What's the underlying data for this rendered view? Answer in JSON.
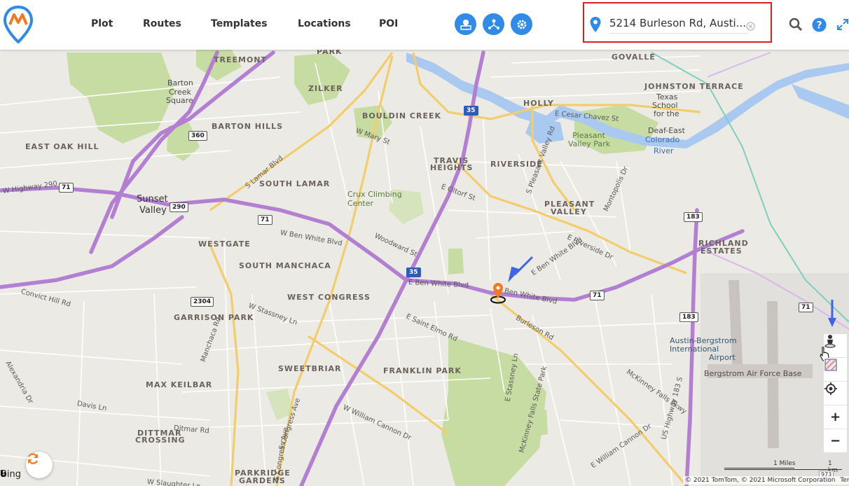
{
  "nav": {
    "items": [
      {
        "label": "Plot"
      },
      {
        "label": "Routes"
      },
      {
        "label": "Templates"
      },
      {
        "label": "Locations"
      },
      {
        "label": "POI"
      }
    ],
    "action_icons": [
      "map-pin-board-icon",
      "people-network-icon",
      "gear-icon"
    ],
    "accent": "#2f8ae8"
  },
  "search": {
    "value": "5214 Burleson Rd, Austi..."
  },
  "map": {
    "neighborhoods": [
      {
        "label": "TREEMONT"
      },
      {
        "label": "ZILKER"
      },
      {
        "label": "BOULDIN CREEK"
      },
      {
        "label": "BARTON HILLS"
      },
      {
        "label": "EAST OAK HILL"
      },
      {
        "label": "SOUTH LAMAR"
      },
      {
        "label": "TRAVIS"
      },
      {
        "label": "HEIGHTS"
      },
      {
        "label": "RIVERSIDE"
      },
      {
        "label": "WESTGATE"
      },
      {
        "label": "SOUTH MANCHACA"
      },
      {
        "label": "WEST CONGRESS"
      },
      {
        "label": "GARRISON PARK"
      },
      {
        "label": "SWEETBRIAR"
      },
      {
        "label": "FRANKLIN PARK"
      },
      {
        "label": "MAX KEILBAR"
      },
      {
        "label": "DITTMAR"
      },
      {
        "label": "CROSSING"
      },
      {
        "label": "PARKRIDGE"
      },
      {
        "label": "GARDENS"
      },
      {
        "label": "GOVALLE"
      },
      {
        "label": "JOHNSTON TERRACE"
      },
      {
        "label": "HOLLY"
      },
      {
        "label": "PLEASANT"
      },
      {
        "label": "VALLEY"
      },
      {
        "label": "RICHLAND"
      },
      {
        "label": "ESTATES"
      },
      {
        "label": "PARK"
      }
    ],
    "places": [
      {
        "label": "Barton"
      },
      {
        "label": "Creek"
      },
      {
        "label": "Square"
      },
      {
        "label": "Sunset"
      },
      {
        "label": "Valley"
      },
      {
        "label": "Crux Climbing"
      },
      {
        "label": "Center"
      },
      {
        "label": "Pleasant"
      },
      {
        "label": "Valley Park"
      },
      {
        "label": "Texas"
      },
      {
        "label": "School"
      },
      {
        "label": "for the"
      },
      {
        "label": "Deaf-East"
      },
      {
        "label": "Austin-Bergstrom"
      },
      {
        "label": "International"
      },
      {
        "label": "Airport"
      },
      {
        "label": "Bergstrom Air Force Base"
      }
    ],
    "water": [
      {
        "label": "Colorado"
      },
      {
        "label": "River"
      }
    ],
    "roads": [
      {
        "label": "W Ben White Blvd"
      },
      {
        "label": "E Ben White Blvd"
      },
      {
        "label": "Ben White Blvd"
      },
      {
        "label": "E Ben White Blvd"
      },
      {
        "label": "S Lamar Blvd"
      },
      {
        "label": "S Congress Ave"
      },
      {
        "label": "S Congress Ave"
      },
      {
        "label": "Burleson Rd"
      },
      {
        "label": "McKinney Falls State Park"
      },
      {
        "label": "W Stassney Ln"
      },
      {
        "label": "E Stassney Ln"
      },
      {
        "label": "W William Cannon Dr"
      },
      {
        "label": "E William Cannon Dr"
      },
      {
        "label": "W Slaughter Ln"
      },
      {
        "label": "E Oltorf St"
      },
      {
        "label": "E Riverside Dr"
      },
      {
        "label": "US Highway 183 S"
      },
      {
        "label": "McKinney Falls Pkwy"
      },
      {
        "label": "W Highway 290"
      },
      {
        "label": "Convict Hill Rd"
      },
      {
        "label": "E Cesar Chavez St"
      },
      {
        "label": "W Mary St"
      },
      {
        "label": "Woodward St"
      },
      {
        "label": "E Saint Elmo Rd"
      },
      {
        "label": "Montopolis Dr"
      },
      {
        "label": "Ditmar Rd"
      },
      {
        "label": "Davis Ln"
      },
      {
        "label": "Manchaca Rd"
      },
      {
        "label": "S Pleasant Valley Rd"
      },
      {
        "label": "Alexandria Dr"
      }
    ],
    "shields": [
      {
        "label": "71"
      },
      {
        "label": "71"
      },
      {
        "label": "71"
      },
      {
        "label": "290"
      },
      {
        "label": "360"
      },
      {
        "label": "35"
      },
      {
        "label": "35"
      },
      {
        "label": "183"
      },
      {
        "label": "183"
      },
      {
        "label": "2304"
      },
      {
        "label": "71"
      }
    ],
    "attribution": "© 2021 TomTom, © 2021 Microsoft Corporation",
    "terms": "Terms",
    "scale_miles": "1 Miles",
    "scale_km": "1 km",
    "scale_px": "973",
    "bing": "Bing"
  },
  "tools": [
    {
      "icon": "street-view-person-icon"
    },
    {
      "icon": "map-layers-icon"
    },
    {
      "icon": "locate-me-icon"
    },
    {
      "icon": "zoom-in-icon",
      "label": "+"
    },
    {
      "icon": "zoom-out-icon",
      "label": "−"
    }
  ],
  "colors": {
    "highway": "#b27fd2",
    "major_road": "#f3cd6b",
    "park": "#c7dca2",
    "water": "#a9c9f0",
    "pin": "#f47a22",
    "annotation": "#d9201f"
  }
}
